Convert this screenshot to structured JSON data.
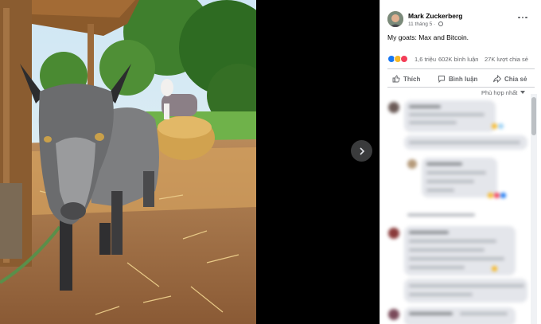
{
  "post": {
    "author": "Mark Zuckerberg",
    "date": "11 tháng 5 · ",
    "caption": "My goats: Max and Bitcoin.",
    "reactions": "1,6 triệu",
    "comments": "602K bình luận",
    "shares": "27K lượt chia sẻ"
  },
  "actions": {
    "like": "Thích",
    "comment": "Bình luận",
    "share": "Chia sẻ"
  },
  "sort_label": "Phù hợp nhất",
  "colors": {
    "accent": "#1877f2",
    "like_blue": "#1877f2",
    "haha_yellow": "#f7b928",
    "love_red": "#f33e58"
  }
}
